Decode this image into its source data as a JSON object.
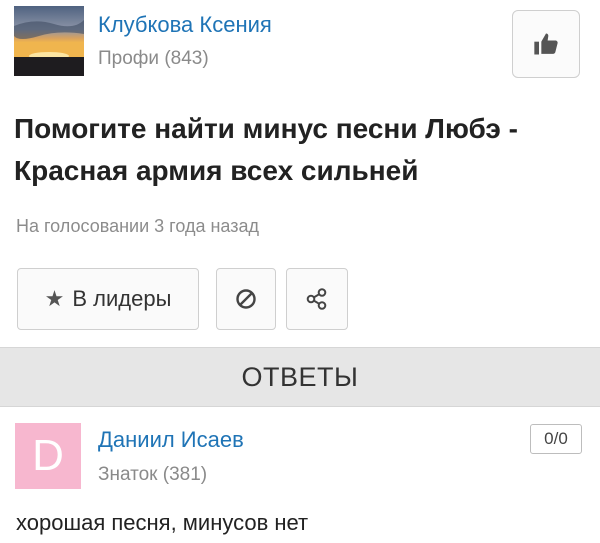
{
  "author": {
    "name": "Клубкова Ксения",
    "rank": "Профи (843)",
    "avatar_icon": "sunset-photo"
  },
  "like_icon": "thumbs-up-icon",
  "question": {
    "title": "Помогите найти минус песни Любэ - Красная армия всех сильней",
    "status": "На голосовании 3 года назад"
  },
  "actions": {
    "leaders_label": "В лидеры",
    "leaders_icon": "star-icon",
    "block_icon": "block-icon",
    "share_icon": "share-icon"
  },
  "answers_header": "ОТВЕТЫ",
  "answer": {
    "avatar_letter": "D",
    "avatar_color": "#f7b7cf",
    "name": "Даниил Исаев",
    "rank": "Знаток (381)",
    "votes": "0/0",
    "text": "хорошая песня, минусов нет"
  },
  "colors": {
    "link": "#1f74b6",
    "muted": "#8a8a8a",
    "bar": "#e6e6e6"
  }
}
